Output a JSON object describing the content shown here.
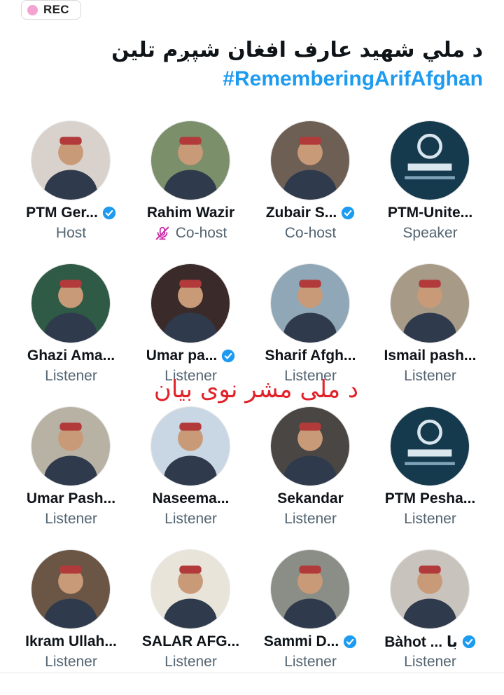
{
  "recording": {
    "label": "REC",
    "dot_color": "#f4a3d0"
  },
  "space": {
    "title": "د ملي شهید عارف افغان شپږم تلین",
    "hashtag": "#RememberingArifAfghan",
    "hashtag_color": "#1d9bf0"
  },
  "overlay_caption": "د ملی مشر نوی بیان",
  "participants": [
    {
      "name": "PTM Ger...",
      "role": "Host",
      "verified": true,
      "muted": false,
      "avatar": "man-speaking-at-microphone-photo",
      "bg": "#d9d2cc"
    },
    {
      "name": "Rahim Wazir",
      "role": "Co-host",
      "verified": false,
      "muted": false,
      "avatar": "man-standing-in-meadow-photo",
      "bg": "#7b8f6a"
    },
    {
      "name": "Zubair S...",
      "role": "Co-host",
      "verified": true,
      "muted": false,
      "avatar": "two-men-side-profile-photo",
      "bg": "#6d5f54"
    },
    {
      "name": "PTM-Unite...",
      "role": "Speaker",
      "verified": false,
      "muted": true,
      "avatar": "pashtun-movement-logo",
      "bg": "#163a4d"
    },
    {
      "name": "Ghazi Ama...",
      "role": "Listener",
      "verified": false,
      "muted": false,
      "avatar": "man-in-blue-outfit-photo",
      "bg": "#2f5a45"
    },
    {
      "name": "Umar pa...",
      "role": "Listener",
      "verified": true,
      "muted": false,
      "avatar": "man-with-red-cap-at-microphone-photo",
      "bg": "#3a2b2a"
    },
    {
      "name": "Sharif Afgh...",
      "role": "Listener",
      "verified": false,
      "muted": false,
      "avatar": "two-men-in-blue-photo",
      "bg": "#8fa7b6"
    },
    {
      "name": "Ismail pash...",
      "role": "Listener",
      "verified": false,
      "muted": false,
      "avatar": "man-in-mountains-photo",
      "bg": "#a79a86"
    },
    {
      "name": "Umar Pash...",
      "role": "Listener",
      "verified": false,
      "muted": false,
      "avatar": "man-seated-outdoors-photo",
      "bg": "#b8b2a4"
    },
    {
      "name": "Naseema...",
      "role": "Listener",
      "verified": false,
      "muted": false,
      "avatar": "embroidered-cap-illustration",
      "bg": "#c9d6e3"
    },
    {
      "name": "Sekandar",
      "role": "Listener",
      "verified": false,
      "muted": false,
      "avatar": "man-with-glowing-eyes-photo",
      "bg": "#4a4644"
    },
    {
      "name": "PTM Pesha...",
      "role": "Listener",
      "verified": false,
      "muted": false,
      "avatar": "pashtun-movement-logo",
      "bg": "#163a4d"
    },
    {
      "name": "Ikram Ullah...",
      "role": "Listener",
      "verified": false,
      "muted": false,
      "avatar": "man-reading-at-desk-photo",
      "bg": "#6b5646"
    },
    {
      "name": "SALAR AFG...",
      "role": "Listener",
      "verified": false,
      "muted": false,
      "avatar": "chained-man-illustration",
      "bg": "#e8e4da"
    },
    {
      "name": "Sammi D...",
      "role": "Listener",
      "verified": true,
      "muted": false,
      "avatar": "woman-with-headscarf-photo",
      "bg": "#8a8e86"
    },
    {
      "name": "Bàhot ... با",
      "role": "Listener",
      "verified": true,
      "muted": false,
      "avatar": "woman-with-red-mask-photo",
      "bg": "#c9c3bd"
    }
  ],
  "colors": {
    "verified_badge": "#1d9bf0",
    "muted_icon": "#c931a8",
    "role_text": "#536471",
    "caption": "#e2222a"
  }
}
